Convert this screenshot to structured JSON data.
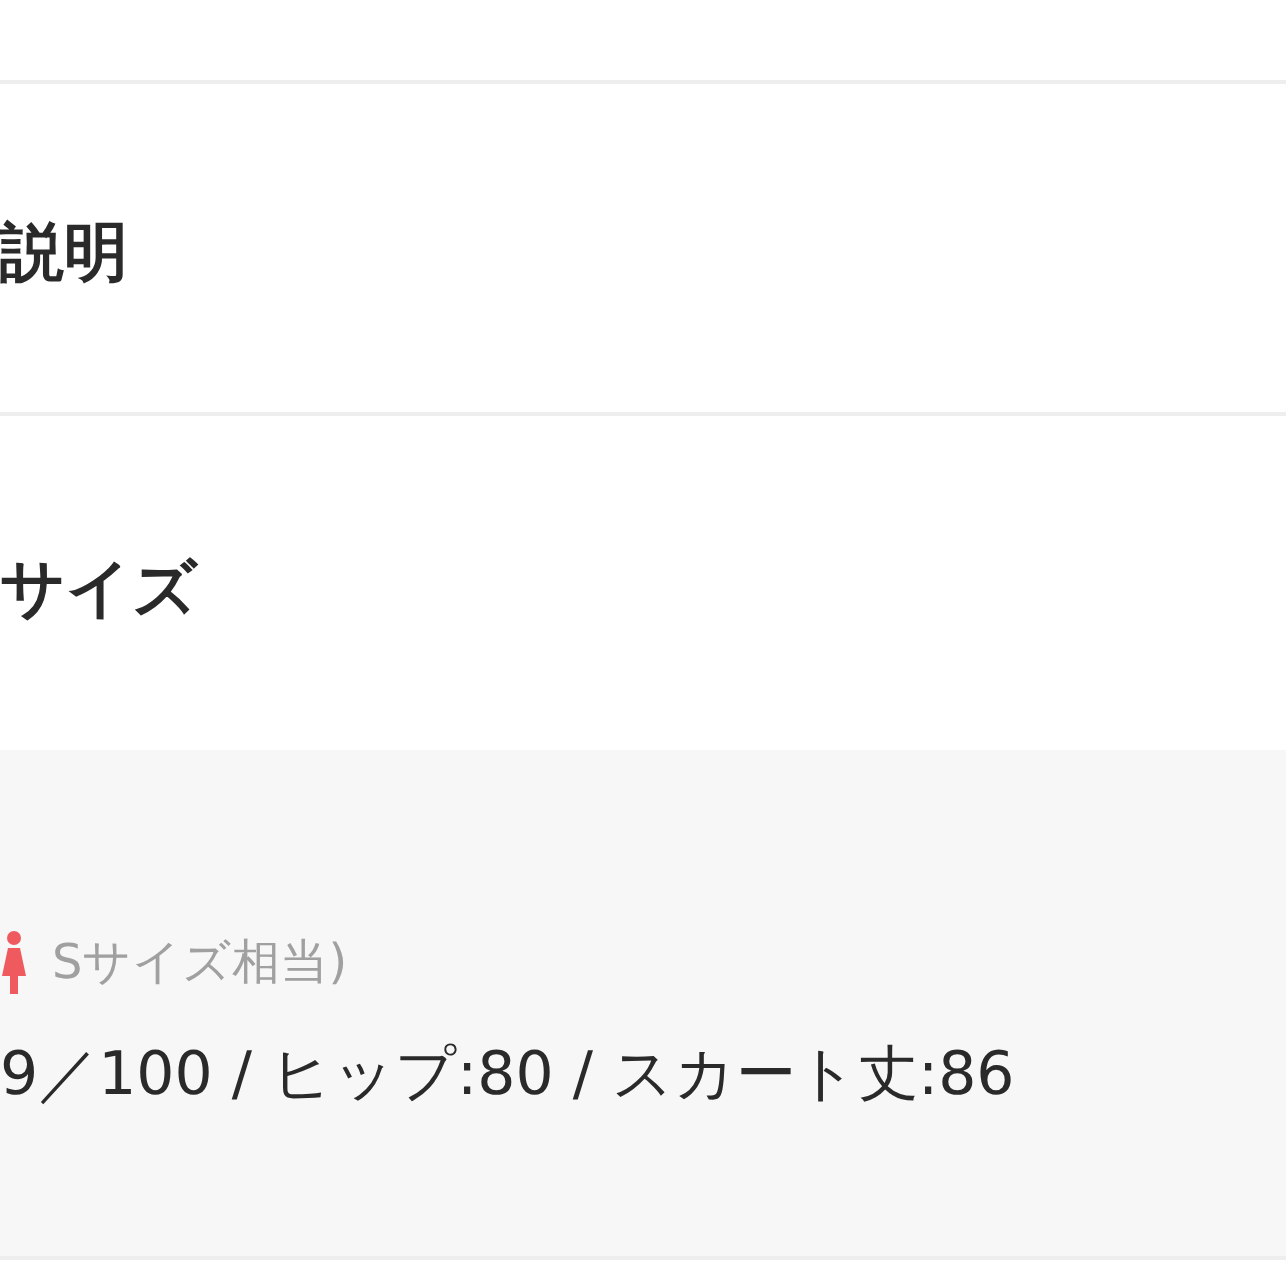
{
  "sections": [
    {
      "title": "説明"
    },
    {
      "title": "サイズ"
    }
  ],
  "size_panel": {
    "note": "Sサイズ相当)",
    "measurements": "9／100 / ヒップ:80 / スカート丈:86"
  }
}
